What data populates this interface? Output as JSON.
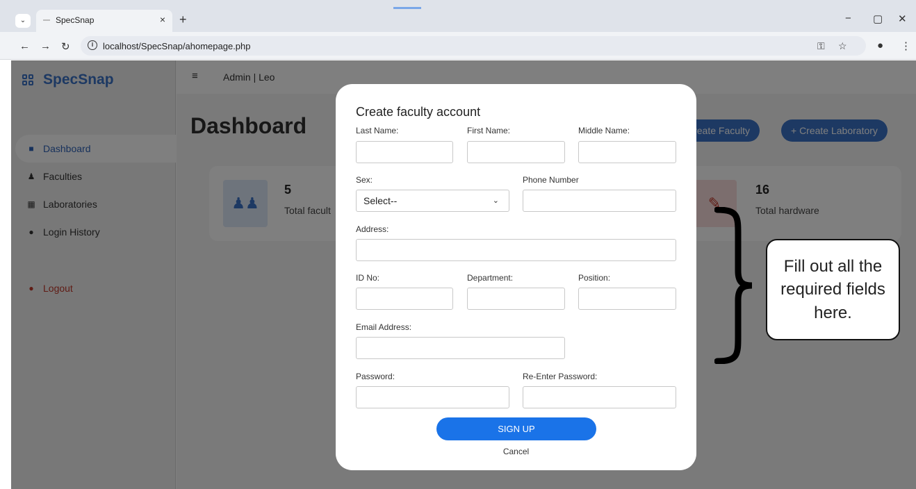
{
  "browser": {
    "tab_title": "SpecSnap",
    "tab_close": "×",
    "new_tab": "+",
    "url": "localhost/SpecSnap/ahomepage.php",
    "window_minimize": "−",
    "window_restore": "▢",
    "window_close": "✕"
  },
  "sidebar": {
    "brand": "SpecSnap",
    "items": [
      {
        "label": "Dashboard",
        "icon": "grid-icon",
        "active": true
      },
      {
        "label": "Faculties",
        "icon": "users-icon"
      },
      {
        "label": "Laboratories",
        "icon": "building-icon"
      },
      {
        "label": "Login History",
        "icon": "clock-icon"
      }
    ],
    "logout": "Logout"
  },
  "topbar": {
    "user": "Admin | Leo"
  },
  "main": {
    "title": "Dashboard",
    "create_faculty": "Create Faculty",
    "create_laboratory": "+ Create Laboratory",
    "stats": [
      {
        "value": "5",
        "label": "Total facult"
      },
      {
        "value": "16",
        "label": "Total hardware"
      }
    ]
  },
  "modal": {
    "title": "Create faculty account",
    "labels": {
      "last_name": "Last Name:",
      "first_name": "First Name:",
      "middle_name": "Middle Name:",
      "sex": "Sex:",
      "phone": "Phone Number",
      "address": "Address:",
      "id_no": "ID No:",
      "department": "Department:",
      "position": "Position:",
      "email": "Email Address:",
      "password": "Password:",
      "reenter_password": "Re-Enter Password:"
    },
    "sex_selected": "Select--",
    "signup": "SIGN UP",
    "cancel": "Cancel"
  },
  "callout": {
    "text": "Fill out all the required fields here."
  },
  "colors": {
    "accent": "#3a72c6",
    "signup": "#1a73e8",
    "logout": "#c0392b"
  }
}
